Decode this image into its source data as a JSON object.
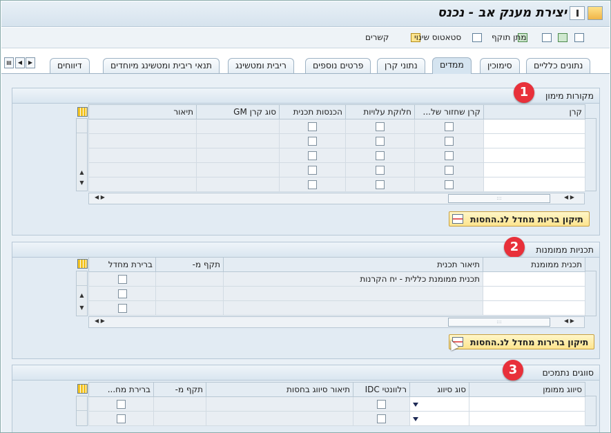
{
  "window": {
    "title": "יצירת מענק אב - נכנס"
  },
  "toolbar": {
    "relations": "קשרים",
    "status_change": "סטאטוס שינוי",
    "validity": "מתן תוקף"
  },
  "tabs": [
    {
      "label": "נתונים כלליים"
    },
    {
      "label": "סימוכין"
    },
    {
      "label": "ממדים",
      "active": true
    },
    {
      "label": "נתוני קרן"
    },
    {
      "label": "פרטים נוספים"
    },
    {
      "label": "ריבית ומטשינג"
    },
    {
      "label": "תנאי ריבית ומטשינג מיוחדים"
    },
    {
      "label": "דיווחים"
    }
  ],
  "section1": {
    "title": "מקורות מימון",
    "badge": "1",
    "columns": [
      "קרן",
      "קרן שחזור של...",
      "חלוקת עלויות",
      "הכנסות תכנית",
      "סוג קרן GM",
      "תיאור"
    ],
    "button": "תיקון בריות מחדל לנ.החסות"
  },
  "section2": {
    "title": "תכניות ממומנות",
    "badge": "2",
    "columns": [
      "תכנית ממומנת",
      "תיאור תכנית",
      "תקף מ-",
      "ברירת מחדל"
    ],
    "row1_desc": "תכנית ממומנת כללית - יח הקרנות",
    "button": "תיקון ברירות מחדל לנ.החסות"
  },
  "section3": {
    "title": "סווגים נתמכים",
    "badge": "3",
    "columns": [
      "סיווג ממומן",
      "סוג סיווג",
      "רלוונטי IDC",
      "תיאור סיווג בחסות",
      "תקף מ-",
      "ברירת מח..."
    ]
  }
}
